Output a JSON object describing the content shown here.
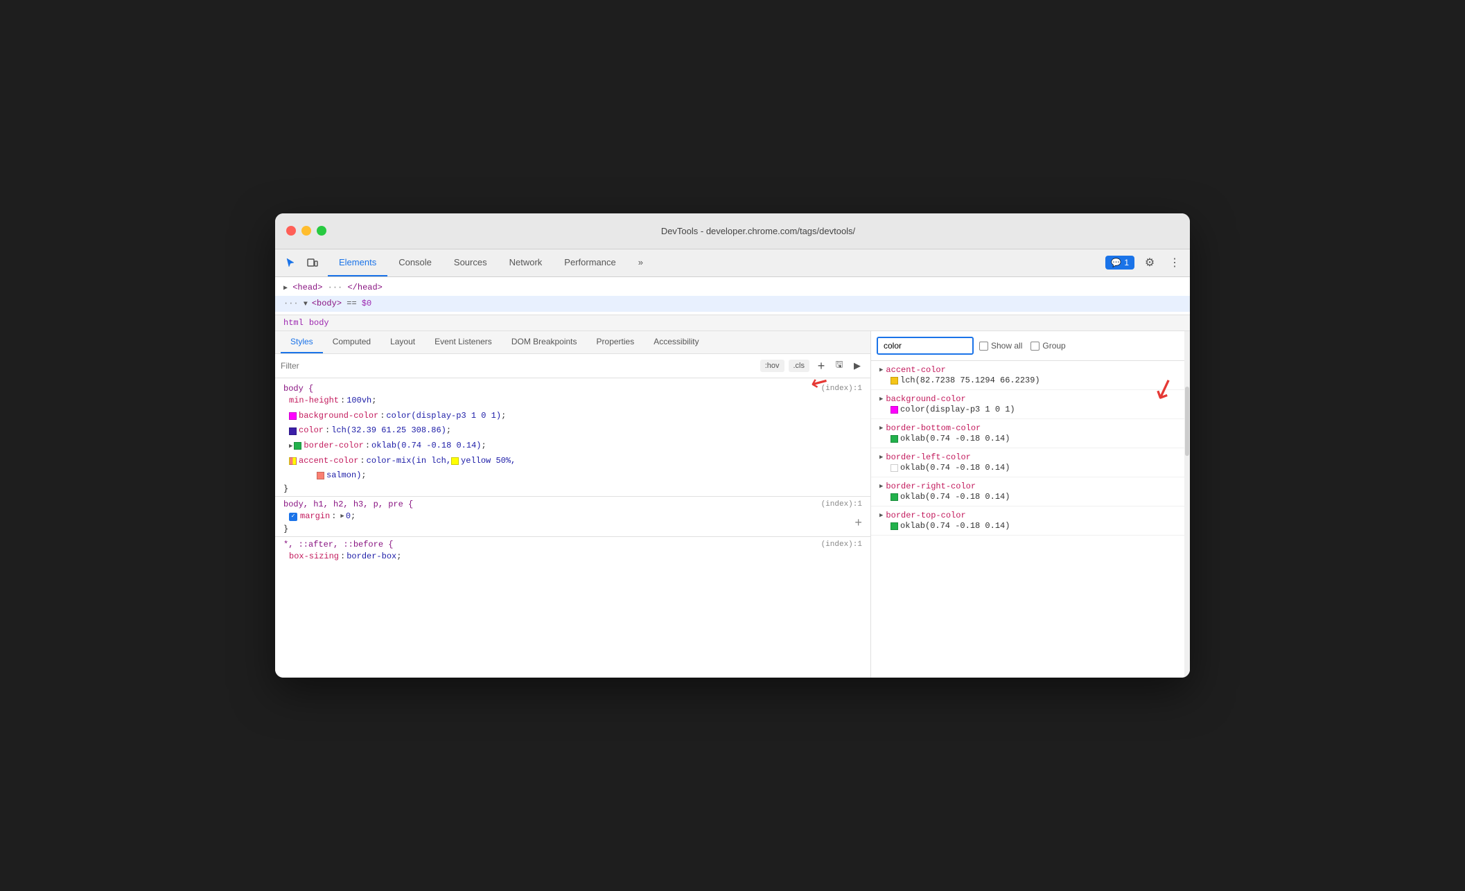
{
  "window": {
    "title": "DevTools - developer.chrome.com/tags/devtools/"
  },
  "toolbar": {
    "tabs": [
      {
        "id": "elements",
        "label": "Elements",
        "active": true
      },
      {
        "id": "console",
        "label": "Console",
        "active": false
      },
      {
        "id": "sources",
        "label": "Sources",
        "active": false
      },
      {
        "id": "network",
        "label": "Network",
        "active": false
      },
      {
        "id": "performance",
        "label": "Performance",
        "active": false
      },
      {
        "id": "more",
        "label": "»",
        "active": false
      }
    ],
    "chat_badge": "💬 1",
    "gear_icon": "⚙",
    "more_icon": "⋮"
  },
  "dom": {
    "head_line": "▶ <head> ··· </head>",
    "body_line": "··· ▼ <body> == $0"
  },
  "breadcrumb": {
    "items": [
      "html",
      "body"
    ]
  },
  "style_tabs": [
    {
      "id": "styles",
      "label": "Styles",
      "active": true
    },
    {
      "id": "computed",
      "label": "Computed",
      "active": false
    },
    {
      "id": "layout",
      "label": "Layout",
      "active": false
    },
    {
      "id": "event-listeners",
      "label": "Event Listeners",
      "active": false
    },
    {
      "id": "dom-breakpoints",
      "label": "DOM Breakpoints",
      "active": false
    },
    {
      "id": "properties",
      "label": "Properties",
      "active": false
    },
    {
      "id": "accessibility",
      "label": "Accessibility",
      "active": false
    }
  ],
  "filter": {
    "placeholder": "Filter",
    "hov_label": ":hov",
    "cls_label": ".cls",
    "add_label": "+",
    "style_icon": "🖫",
    "play_icon": "▶"
  },
  "css_rules": [
    {
      "selector": "body {",
      "file_link": "(index):1",
      "properties": [
        {
          "name": "min-height",
          "value": "100vh",
          "has_swatch": false,
          "swatch_color": null
        },
        {
          "name": "background-color",
          "value": "color(display-p3 1 0 1)",
          "has_swatch": true,
          "swatch_color": "#ff00ff"
        },
        {
          "name": "color",
          "value": "lch(32.39 61.25 308.86)",
          "has_swatch": true,
          "swatch_color": "#3b1fa8"
        },
        {
          "name": "border-color",
          "value": "oklab(0.74 -0.18 0.14)",
          "has_swatch": true,
          "swatch_color": "#22b14c",
          "has_expand": true
        },
        {
          "name": "accent-color",
          "value": "color-mix(in lch, yellow 50%, salmon)",
          "has_swatch": true,
          "swatch_color": "mixed",
          "has_yellow_swatch": true
        }
      ],
      "closing": "}"
    },
    {
      "selector": "body, h1, h2, h3, p, pre {",
      "file_link": "(index):1",
      "properties": [
        {
          "name": "margin",
          "value": "0",
          "has_swatch": false,
          "swatch_color": null,
          "has_expand": true,
          "has_checkbox": true
        }
      ],
      "closing": "}",
      "has_add_btn": true
    },
    {
      "selector": "*, ::after, ::before {",
      "file_link": "(index):1",
      "properties": [
        {
          "name": "box-sizing",
          "value": "border-box",
          "truncated": true
        }
      ]
    }
  ],
  "computed_panel": {
    "search_placeholder": "color",
    "show_all_label": "Show all",
    "group_label": "Group",
    "properties": [
      {
        "name": "accent-color",
        "value": "lch(82.7238 75.1294 66.2239)",
        "swatch_color": "#f5c518",
        "has_arrow": true
      },
      {
        "name": "background-color",
        "value": "color(display-p3 1 0 1)",
        "swatch_color": "#ff00ff",
        "has_arrow": true
      },
      {
        "name": "border-bottom-color",
        "value": "oklab(0.74 -0.18 0.14)",
        "swatch_color": "#22b14c",
        "has_arrow": true
      },
      {
        "name": "border-left-color",
        "value": "oklab(0.74 -0.18 0.14)",
        "swatch_color": "#22b14c",
        "has_arrow": true
      },
      {
        "name": "border-right-color",
        "value": "oklab(0.74 -0.18 0.14)",
        "swatch_color": "#22b14c",
        "has_arrow": true
      },
      {
        "name": "border-top-color",
        "value": "oklab(0.74 -0.18 0.14)",
        "swatch_color": "#22b14c",
        "has_arrow": true
      }
    ]
  }
}
